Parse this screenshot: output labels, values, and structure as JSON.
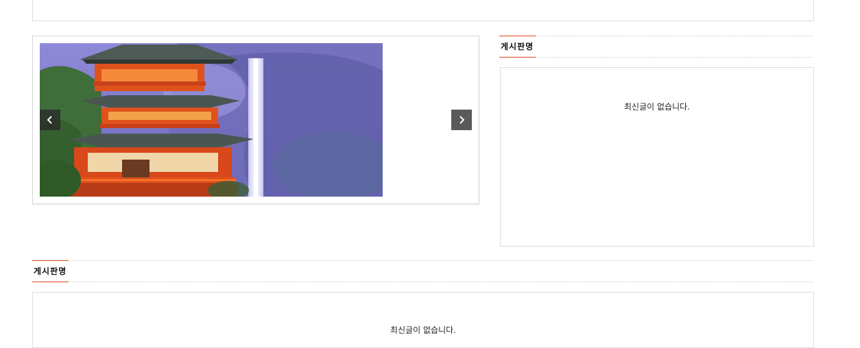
{
  "slider": {
    "image_alt": "Pagoda with waterfall",
    "prev_icon": "chevron-left-icon",
    "next_icon": "chevron-right-icon"
  },
  "board_right": {
    "title": "게시판명",
    "empty_message": "최신글이 없습니다."
  },
  "board_bottom": {
    "title": "게시판명",
    "empty_message": "최신글이 없습니다."
  },
  "colors": {
    "accent": "#d9471f",
    "pagoda": "#e0521c",
    "mist": "#7c78c8"
  }
}
